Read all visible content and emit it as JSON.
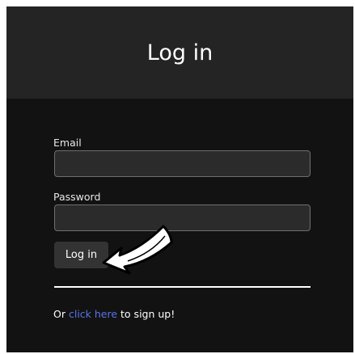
{
  "header": {
    "title": "Log in"
  },
  "form": {
    "email_label": "Email",
    "email_value": "",
    "password_label": "Password",
    "password_value": "",
    "submit_label": "Log in"
  },
  "footer": {
    "prefix": "Or",
    "link_text": "click here",
    "suffix": "to sign up!"
  },
  "colors": {
    "background": "#121212",
    "header_background": "#242424",
    "link": "#5b73e8"
  },
  "icons": {
    "cursor": "pointing-arrow-icon"
  }
}
